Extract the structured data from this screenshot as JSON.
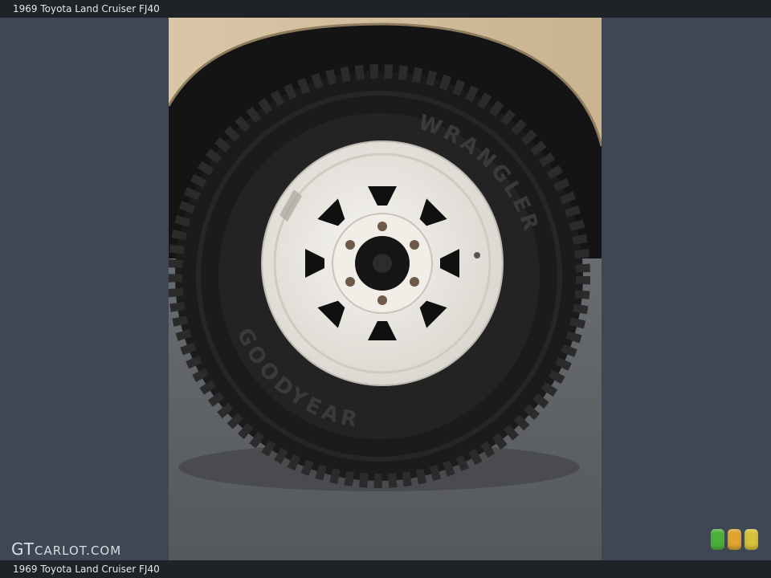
{
  "header": {
    "title": "1969 Toyota Land Cruiser FJ40"
  },
  "footer": {
    "caption": "1969 Toyota Land Cruiser FJ40"
  },
  "watermark": {
    "main": "GT",
    "rest": "CARLOT.COM"
  },
  "photo": {
    "subject": "wheel-tire-photo"
  },
  "tire": {
    "brand": "GOODYEAR",
    "model": "WRANGLER"
  },
  "indicators": {
    "colors": [
      "#4caf3a",
      "#e0a531",
      "#d6c33a"
    ]
  }
}
